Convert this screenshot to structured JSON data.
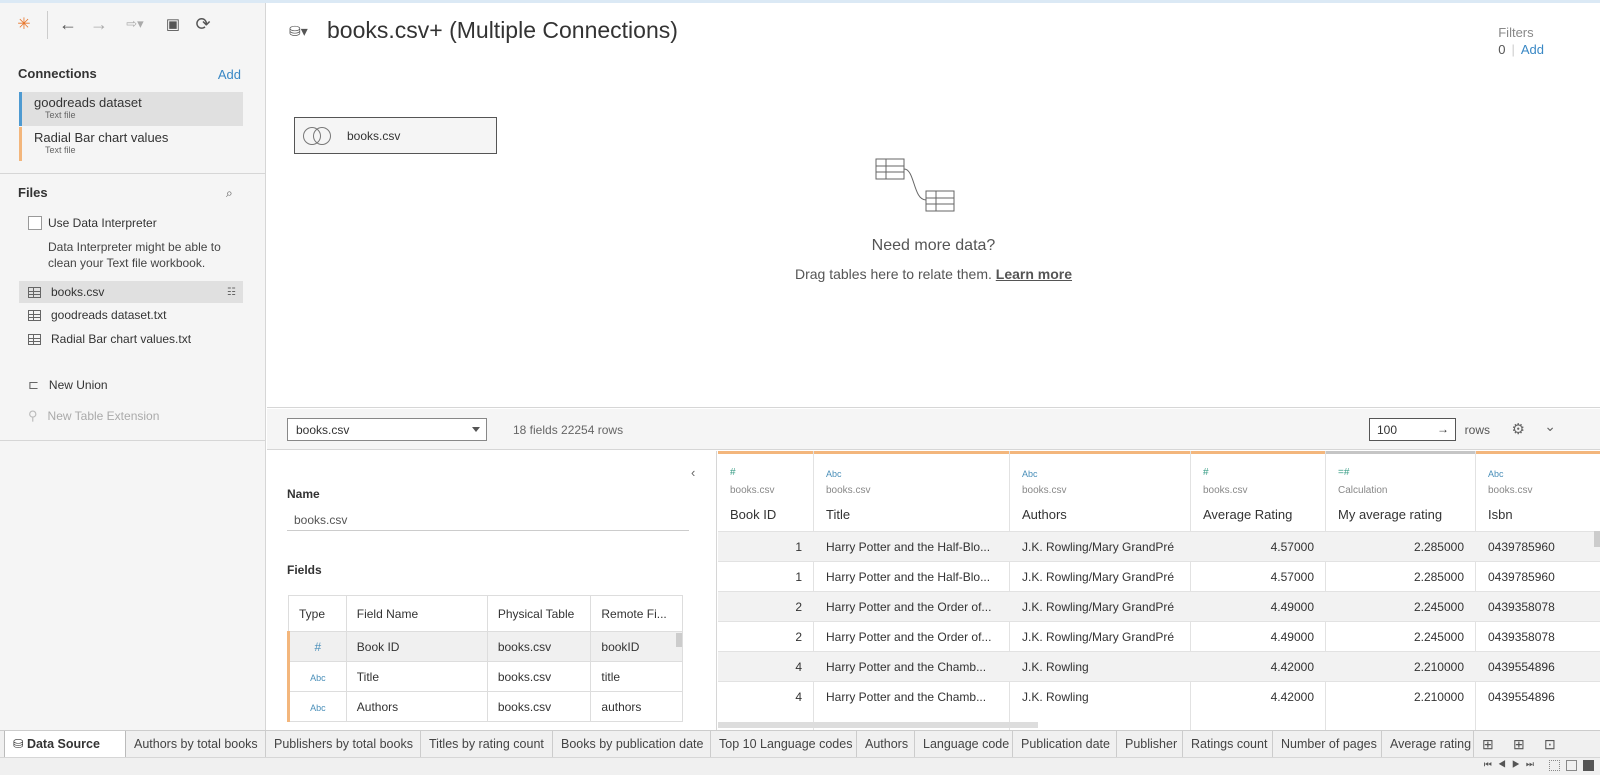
{
  "colors": {
    "accent": "#3a88c5",
    "connection_blue": "#4e9ad1",
    "connection_orange": "#f3b67c",
    "number_green": "#3b9e87"
  },
  "toolbar": {
    "icons": [
      "tableau-logo-icon",
      "back-icon",
      "forward-icon",
      "redo-icon",
      "save-icon",
      "refresh-icon"
    ]
  },
  "connections": {
    "title": "Connections",
    "add_label": "Add",
    "items": [
      {
        "name": "goodreads dataset",
        "type": "Text file"
      },
      {
        "name": "Radial Bar chart values",
        "type": "Text file"
      }
    ]
  },
  "files": {
    "title": "Files",
    "interpreter_label": "Use Data Interpreter",
    "interpreter_hint": "Data Interpreter might be able to clean your Text file workbook.",
    "items": [
      "books.csv",
      "goodreads dataset.txt",
      "Radial Bar chart values.txt"
    ],
    "new_union": "New Union",
    "new_table_extension": "New Table Extension"
  },
  "canvas": {
    "title": "books.csv+ (Multiple Connections)",
    "filters_label": "Filters",
    "filters_count": "0",
    "filters_add": "Add",
    "table_card": "books.csv",
    "need_more_title": "Need more data?",
    "need_more_body": "Drag tables here to relate them.",
    "learn_more": "Learn more"
  },
  "midbar": {
    "selected_table": "books.csv",
    "fields_info": "18 fields 22254 rows",
    "rows_value": "100",
    "rows_label": "rows"
  },
  "meta": {
    "name_label": "Name",
    "name_value": "books.csv",
    "fields_label": "Fields",
    "headers": [
      "Type",
      "Field Name",
      "Physical Table",
      "Remote Fi..."
    ],
    "rows": [
      {
        "type": "#",
        "name": "Book ID",
        "table": "books.csv",
        "remote": "bookID"
      },
      {
        "type": "Abc",
        "name": "Title",
        "table": "books.csv",
        "remote": "title"
      },
      {
        "type": "Abc",
        "name": "Authors",
        "table": "books.csv",
        "remote": "authors"
      }
    ]
  },
  "grid": {
    "columns": [
      {
        "icon": "#",
        "source": "books.csv",
        "name": "Book ID"
      },
      {
        "icon": "Abc",
        "source": "books.csv",
        "name": "Title"
      },
      {
        "icon": "Abc",
        "source": "books.csv",
        "name": "Authors"
      },
      {
        "icon": "#",
        "source": "books.csv",
        "name": "Average Rating"
      },
      {
        "icon": "=#",
        "source": "Calculation",
        "name": "My average rating"
      },
      {
        "icon": "Abc",
        "source": "books.csv",
        "name": "Isbn"
      }
    ],
    "rows": [
      [
        "1",
        "Harry Potter and the Half-Blo...",
        "J.K. Rowling/Mary GrandPré",
        "4.57000",
        "2.285000",
        "0439785960"
      ],
      [
        "1",
        "Harry Potter and the Half-Blo...",
        "J.K. Rowling/Mary GrandPré",
        "4.57000",
        "2.285000",
        "0439785960"
      ],
      [
        "2",
        "Harry Potter and the Order of...",
        "J.K. Rowling/Mary GrandPré",
        "4.49000",
        "2.245000",
        "0439358078"
      ],
      [
        "2",
        "Harry Potter and the Order of...",
        "J.K. Rowling/Mary GrandPré",
        "4.49000",
        "2.245000",
        "0439358078"
      ],
      [
        "4",
        "Harry Potter and the Chamb...",
        "J.K. Rowling",
        "4.42000",
        "2.210000",
        "0439554896"
      ],
      [
        "4",
        "Harry Potter and the Chamb...",
        "J.K. Rowling",
        "4.42000",
        "2.210000",
        "0439554896"
      ]
    ]
  },
  "tabs": {
    "items": [
      "Data Source",
      "Authors by total books",
      "Publishers by total books",
      "Titles by rating count",
      "Books by publication date",
      "Top 10 Language codes",
      "Authors",
      "Language code",
      "Publication date",
      "Publisher",
      "Ratings count",
      "Number of pages",
      "Average rating"
    ],
    "active": "Data Source"
  }
}
